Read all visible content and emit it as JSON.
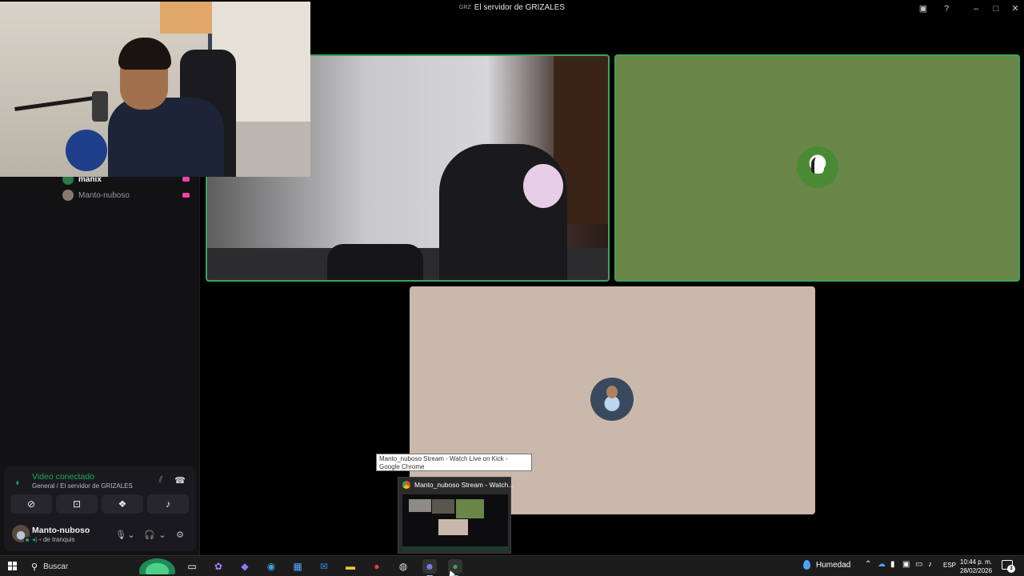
{
  "window": {
    "title": "El servidor de GRIZALES",
    "controls": [
      "inbox-icon",
      "help-icon",
      "minimize-icon",
      "maximize-icon",
      "close-icon"
    ]
  },
  "sidebar": {
    "members": [
      {
        "name": "manix",
        "color": "#ffffff",
        "streaming": true
      },
      {
        "name": "Manto-nuboso",
        "color": "#949ba4",
        "streaming": true
      }
    ]
  },
  "video_tiles": [
    {
      "label": "camera-feed-1",
      "border": "#3ba55c"
    },
    {
      "label": "snoopy-avatar-tile",
      "bg": "#6a8649",
      "border": "#3ba55c"
    },
    {
      "label": "manto-nuboso-avatar-tile",
      "bg": "#cbb8ac"
    }
  ],
  "voice_panel": {
    "title": "Video conectado",
    "subtitle": "General / El servidor de GRIZALES",
    "buttons": [
      "camera-off-icon",
      "screen-share-icon",
      "activities-icon",
      "soundboard-icon"
    ]
  },
  "user": {
    "name": "Manto-nuboso",
    "status": "de tranquis"
  },
  "tooltip": {
    "text": "Manto_nuboso Stream - Watch Live on Kick - Google Chrome"
  },
  "preview": {
    "title": "Manto_nuboso Stream - Watch..."
  },
  "taskbar": {
    "search_placeholder": "Buscar",
    "weather": "Humedad",
    "language": "ESP",
    "time": "10:44 p. m.",
    "date": "28/02/2026",
    "notifications": "3"
  }
}
